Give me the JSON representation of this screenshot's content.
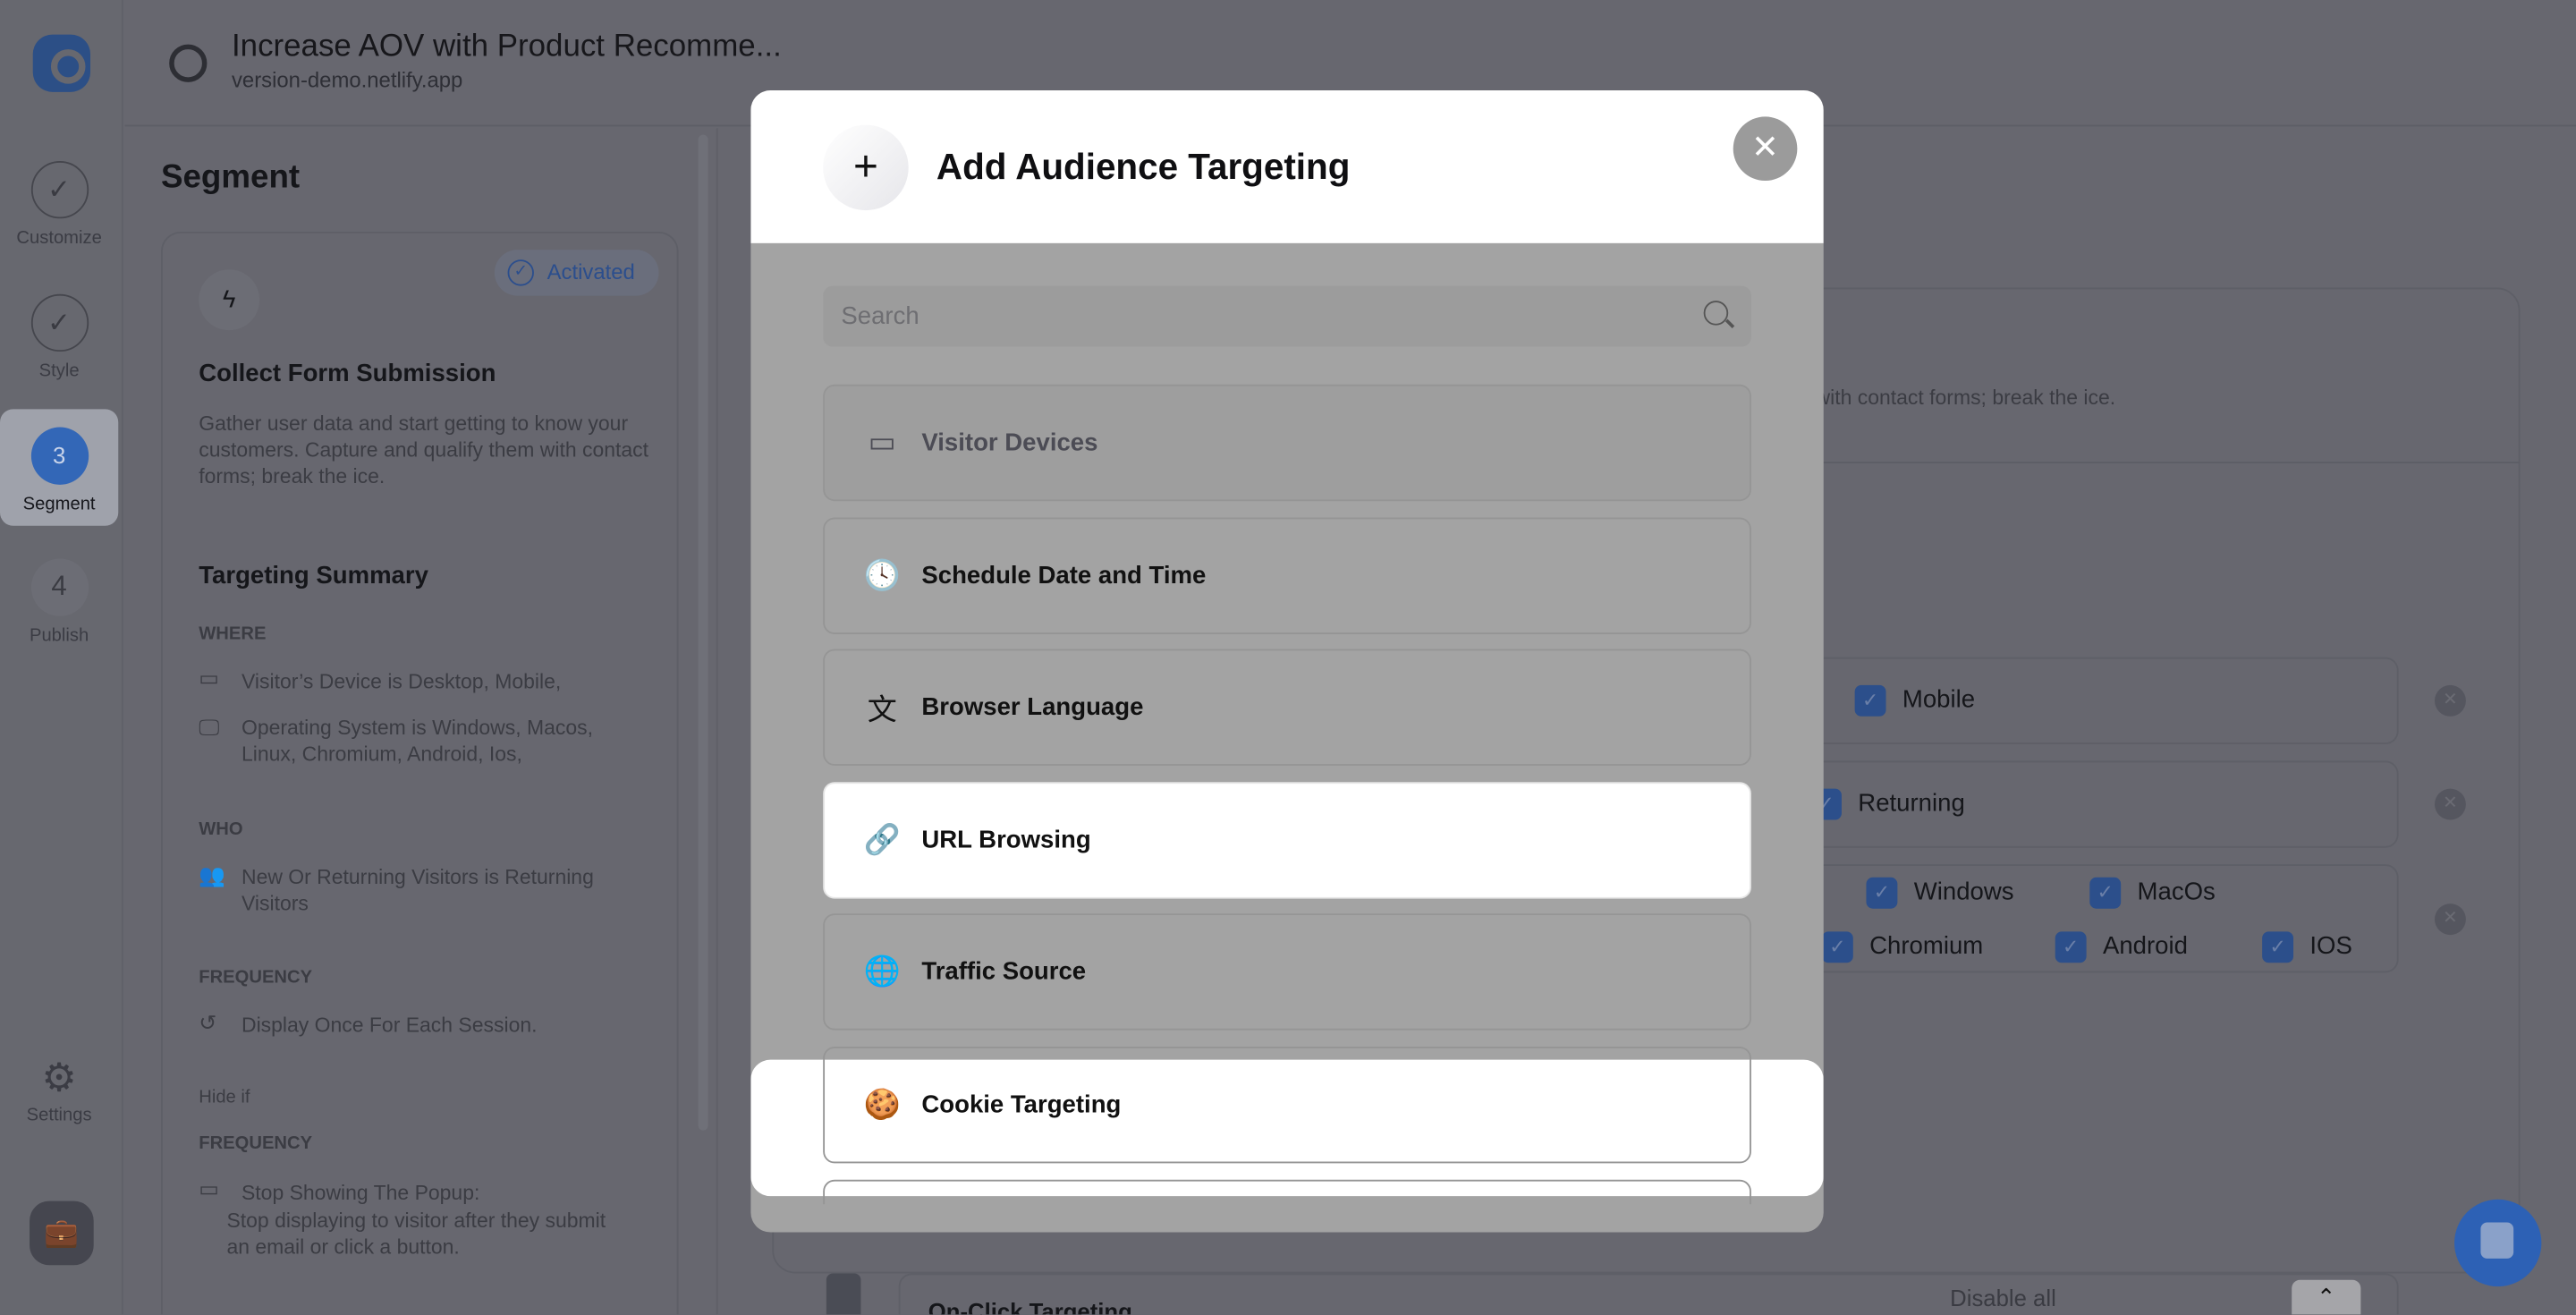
{
  "header": {
    "title": "Increase AOV with Product Recomme...",
    "subtitle": "version-demo.netlify.app",
    "icon": "globe-icon"
  },
  "steps": [
    {
      "label": "Customize",
      "marker": "✓",
      "state": "done"
    },
    {
      "label": "Style",
      "marker": "✓",
      "state": "done"
    },
    {
      "label": "Segment",
      "marker": "3",
      "state": "active"
    },
    {
      "label": "Publish",
      "marker": "4",
      "state": "pending"
    }
  ],
  "rail": {
    "settings_label": "Settings"
  },
  "panel": {
    "title": "Segment",
    "badge": "Activated",
    "card_title": "Collect Form Submission",
    "card_desc": "Gather user data and start getting to know your customers. Capture and qualify them with contact forms; break the ice.",
    "summary_title": "Targeting Summary",
    "where_label": "WHERE",
    "where_items": [
      "Visitor’s Device is Desktop, Mobile,",
      "Operating System is Windows, Macos, Linux, Chromium, Android, Ios,"
    ],
    "who_label": "WHO",
    "who_item": "New Or Returning Visitors is Returning Visitors",
    "freq_label": "FREQUENCY",
    "freq_item": "Display Once For Each Session.",
    "hide_label": "Hide if",
    "freq2_label": "FREQUENCY",
    "freq2_title": "Stop Showing The Popup:",
    "freq2_desc": "Stop displaying to visitor after they submit an email or click a button."
  },
  "main": {
    "desc_fragment": "with contact forms; break the ice.",
    "rows": [
      {
        "options": [
          "Mobile"
        ]
      },
      {
        "options": [
          "Returning"
        ]
      },
      {
        "options": [
          "Windows",
          "MacOs",
          "Chromium",
          "Android",
          "IOS"
        ]
      }
    ],
    "on_click_label": "On-Click Targeting",
    "disable_all": "Disable all"
  },
  "modal": {
    "title": "Add Audience Targeting",
    "search_placeholder": "Search",
    "items": [
      {
        "label": "Visitor Devices",
        "icon": "devices-icon",
        "state": "disabled"
      },
      {
        "label": "Schedule Date and Time",
        "icon": "clock-icon",
        "state": "normal"
      },
      {
        "label": "Browser Language",
        "icon": "translate-icon",
        "state": "normal"
      },
      {
        "label": "URL Browsing",
        "icon": "link-icon",
        "state": "highlighted"
      },
      {
        "label": "Traffic Source",
        "icon": "globe-search-icon",
        "state": "normal"
      },
      {
        "label": "Cookie Targeting",
        "icon": "cookie-icon",
        "state": "normal"
      }
    ]
  },
  "colors": {
    "accent": "#3367b7",
    "overlay": "#67676f",
    "modal_body": "#a3a3a3"
  }
}
